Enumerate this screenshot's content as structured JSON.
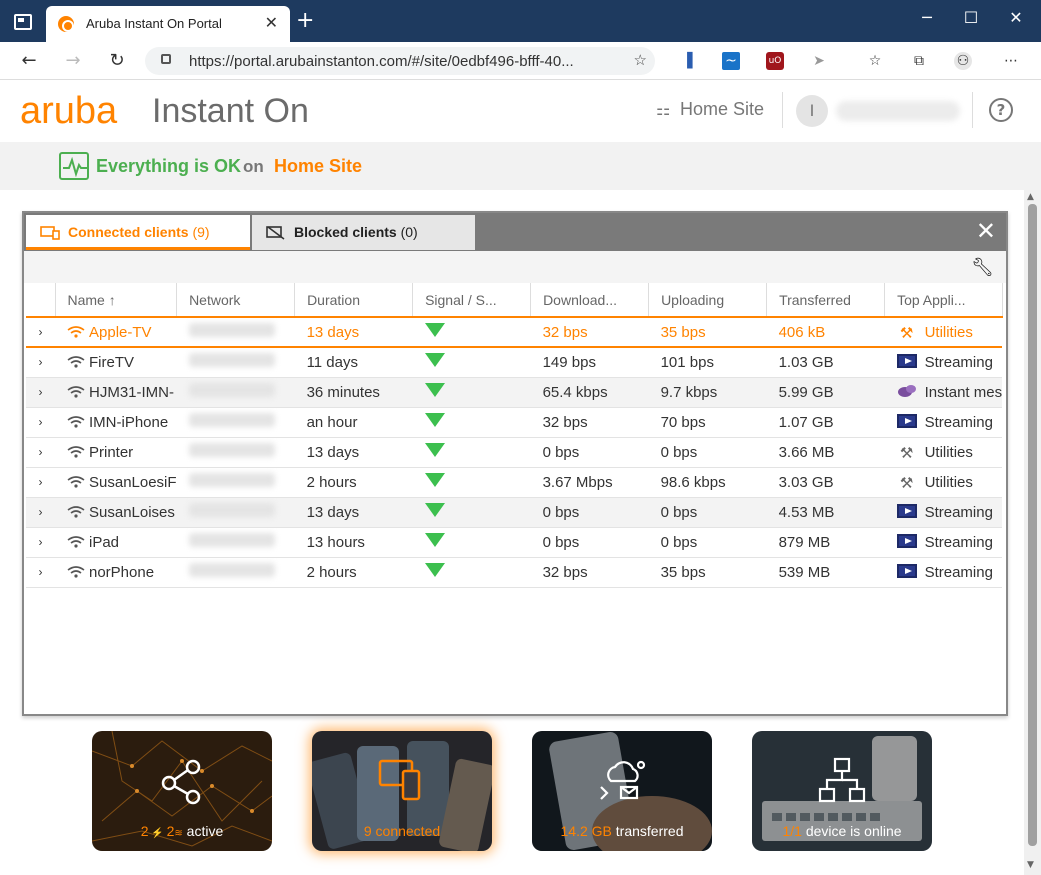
{
  "browser": {
    "tab_title": "Aruba Instant On Portal",
    "url": "https://portal.arubainstanton.com/#/site/0edbf496-bfff-40...",
    "new_tab": "+",
    "minimize": "─",
    "maximize": "☐",
    "close": "✕"
  },
  "header": {
    "logo_brand": "aruba",
    "logo_product": "Instant On",
    "site_label": "Home Site",
    "avatar_letter": "I",
    "help": "?"
  },
  "status": {
    "message": "Everything is OK",
    "on": "on",
    "site": "Home Site"
  },
  "panel": {
    "tab_connected_label": "Connected clients",
    "tab_connected_count": "(9)",
    "tab_blocked_label": "Blocked clients",
    "tab_blocked_count": "(0)",
    "close": "✕",
    "columns": [
      "Name ↑",
      "Network",
      "Duration",
      "Signal / S...",
      "Download...",
      "Uploading",
      "Transferred",
      "Top Appli..."
    ],
    "rows": [
      {
        "name": "Apple-TV",
        "duration": "13 days",
        "download": "32 bps",
        "upload": "35 bps",
        "transferred": "406 kB",
        "app": "Utilities",
        "app_icon": "tools-icon"
      },
      {
        "name": "FireTV",
        "duration": "11 days",
        "download": "149 bps",
        "upload": "101 bps",
        "transferred": "1.03 GB",
        "app": "Streaming",
        "app_icon": "streaming-icon"
      },
      {
        "name": "HJM31-IMN-",
        "duration": "36 minutes",
        "download": "65.4 kbps",
        "upload": "9.7 kbps",
        "transferred": "5.99 GB",
        "app": "Instant mes",
        "app_icon": "chat-icon"
      },
      {
        "name": "IMN-iPhone",
        "duration": "an hour",
        "download": "32 bps",
        "upload": "70 bps",
        "transferred": "1.07 GB",
        "app": "Streaming",
        "app_icon": "streaming-icon"
      },
      {
        "name": "Printer",
        "duration": "13 days",
        "download": "0 bps",
        "upload": "0 bps",
        "transferred": "3.66 MB",
        "app": "Utilities",
        "app_icon": "tools-icon"
      },
      {
        "name": "SusanLoesiF",
        "duration": "2 hours",
        "download": "3.67 Mbps",
        "upload": "98.6 kbps",
        "transferred": "3.03 GB",
        "app": "Utilities",
        "app_icon": "tools-icon"
      },
      {
        "name": "SusanLoises",
        "duration": "13 days",
        "download": "0 bps",
        "upload": "0 bps",
        "transferred": "4.53 MB",
        "app": "Streaming",
        "app_icon": "streaming-icon"
      },
      {
        "name": "iPad",
        "duration": "13 hours",
        "download": "0 bps",
        "upload": "0 bps",
        "transferred": "879 MB",
        "app": "Streaming",
        "app_icon": "streaming-icon"
      },
      {
        "name": "norPhone",
        "duration": "2 hours",
        "download": "32 bps",
        "upload": "35 bps",
        "transferred": "539 MB",
        "app": "Streaming",
        "app_icon": "streaming-icon"
      }
    ]
  },
  "cards": [
    {
      "num": "2",
      "num2": "2",
      "label": "active"
    },
    {
      "num": "9",
      "label": "connected"
    },
    {
      "num": "14.2 GB",
      "label": "transferred"
    },
    {
      "num": "1/1",
      "label": "device is online"
    }
  ],
  "colors": {
    "accent": "#ff8300",
    "ok": "#4caf50",
    "signal": "#3cbf4e",
    "titlebar": "#1e3a5f"
  }
}
